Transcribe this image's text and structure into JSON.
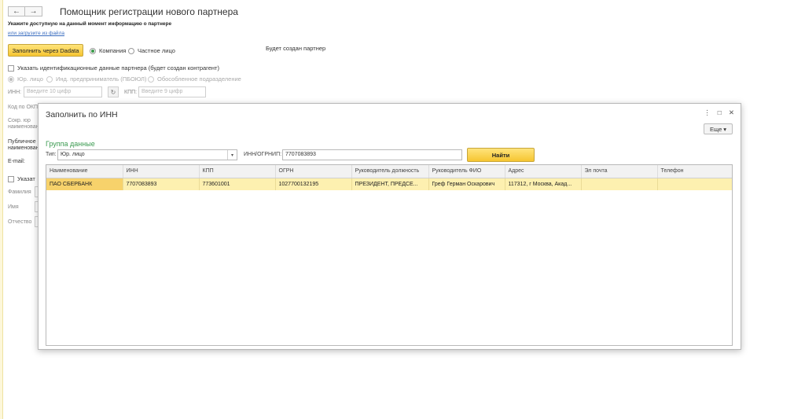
{
  "main": {
    "back_arrow": "←",
    "forward_arrow": "→",
    "title": "Помощник регистрации нового партнера",
    "hint": "Укажите доступную на данный момент информацию о партнере",
    "load_link": "или загрузите из файла",
    "dadata_button": "Заполнить через Dadata",
    "radio_company": "Компания",
    "radio_person": "Частное лицо",
    "partner_status": "Будет создан партнер",
    "id_checkbox": "Указать идентификационные данные партнера (будет создан контрагент)",
    "radio_legal": "Юр. лицо",
    "radio_ie": "Инд. предприниматель (ПБОЮЛ)",
    "radio_division": "Обособленное подразделение",
    "inn_label": "ИНН:",
    "inn_placeholder": "Введите 10 цифр",
    "kpp_label": "КПП:",
    "kpp_placeholder": "Введите 9 цифр",
    "okpo_label": "Код по ОКП",
    "short_name_label_1": "Сокр. юр",
    "short_name_label_2": "наименован",
    "public_name_label_1": "Публичное",
    "public_name_label_2": "наименован",
    "email_label": "E-mail:",
    "indicate_checkbox": "Указат",
    "surname_label": "Фамилия",
    "name_label": "Имя",
    "patronymic_label": "Отчество"
  },
  "dialog": {
    "title": "Заполнить по ИНН",
    "menu_glyph": "⋮",
    "maximize_glyph": "□",
    "close_glyph": "✕",
    "more_button": "Еще",
    "more_arrow": "▾",
    "group_title": "Группа данные",
    "type_label": "Тип:",
    "type_value": "Юр. лицо",
    "type_arrow": "▾",
    "inn_ogrnip_label": "ИНН/ОГРНИП:",
    "inn_ogrnip_value": "7707083893",
    "find_button": "Найти",
    "columns": [
      "Наименование",
      "ИНН",
      "КПП",
      "ОГРН",
      "Руководитель должность",
      "Руководитель ФИО",
      "Адрес",
      "Эл почта",
      "Телефон"
    ],
    "rows": [
      [
        "ПАО СБЕРБАНК",
        "7707083893",
        "773601001",
        "1027700132195",
        "ПРЕЗИДЕНТ, ПРЕДСЕ...",
        "Греф Герман Оскарович",
        "117312, г Москва, Акад...",
        "",
        ""
      ]
    ]
  }
}
